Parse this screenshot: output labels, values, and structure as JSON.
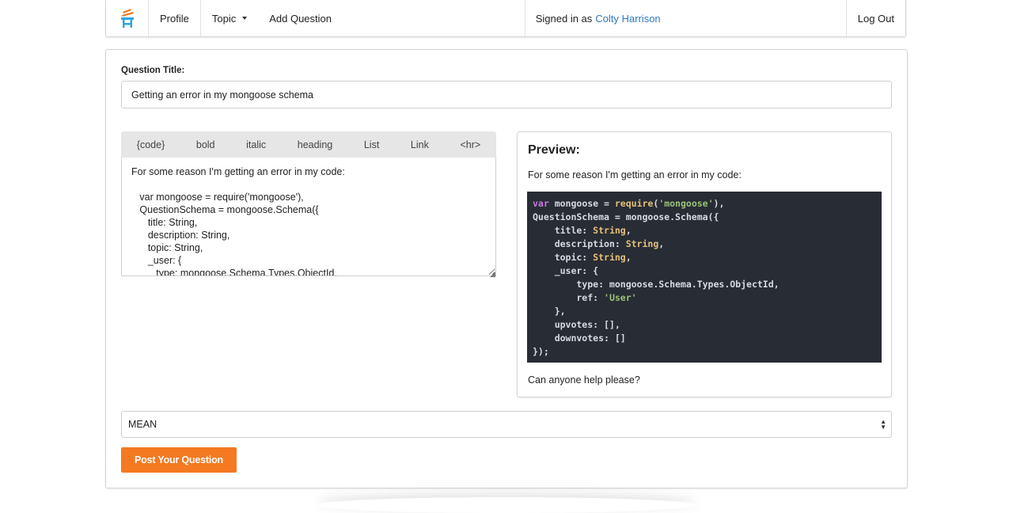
{
  "nav": {
    "items": [
      {
        "label": "Profile"
      },
      {
        "label": "Topic"
      },
      {
        "label": "Add Question"
      }
    ],
    "signed_in_prefix": "Signed in as",
    "user_name": "Colty Harrison",
    "logout_label": "Log Out"
  },
  "form": {
    "title_label": "Question Title:",
    "title_value": "Getting an error in my mongoose schema",
    "toolbar": [
      "{code}",
      "bold",
      "italic",
      "heading",
      "List",
      "Link",
      "<hr>"
    ],
    "body_text": "For some reason I'm getting an error in my code:\n\n   var mongoose = require('mongoose'),\n   QuestionSchema = mongoose.Schema({\n      title: String,\n      description: String,\n      topic: String,\n      _user: {\n         type: mongoose.Schema.Types.ObjectId,",
    "topic_selected": "MEAN",
    "submit_label": "Post Your Question"
  },
  "preview": {
    "heading": "Preview:",
    "intro": "For some reason I'm getting an error in my code:",
    "outro": "Can anyone help please?",
    "code": {
      "l1_kw": "var",
      "l1_a": " mongoose = ",
      "l1_fn": "require",
      "l1_b": "(",
      "l1_str": "'mongoose'",
      "l1_c": "),",
      "l2": "QuestionSchema = mongoose.Schema({",
      "l3_a": "    title: ",
      "l3_ty": "String",
      "l3_b": ",",
      "l4_a": "    description: ",
      "l4_ty": "String",
      "l4_b": ",",
      "l5_a": "    topic: ",
      "l5_ty": "String",
      "l5_b": ",",
      "l6": "    _user: {",
      "l7": "        type: mongoose.Schema.Types.ObjectId,",
      "l8_a": "        ref: ",
      "l8_str": "'User'",
      "l9": "    },",
      "l10": "    upvotes: [],",
      "l11": "    downvotes: []",
      "l12": "});"
    }
  },
  "colors": {
    "accent": "#f47920",
    "link": "#2f7abf",
    "code_bg": "#282c34"
  }
}
